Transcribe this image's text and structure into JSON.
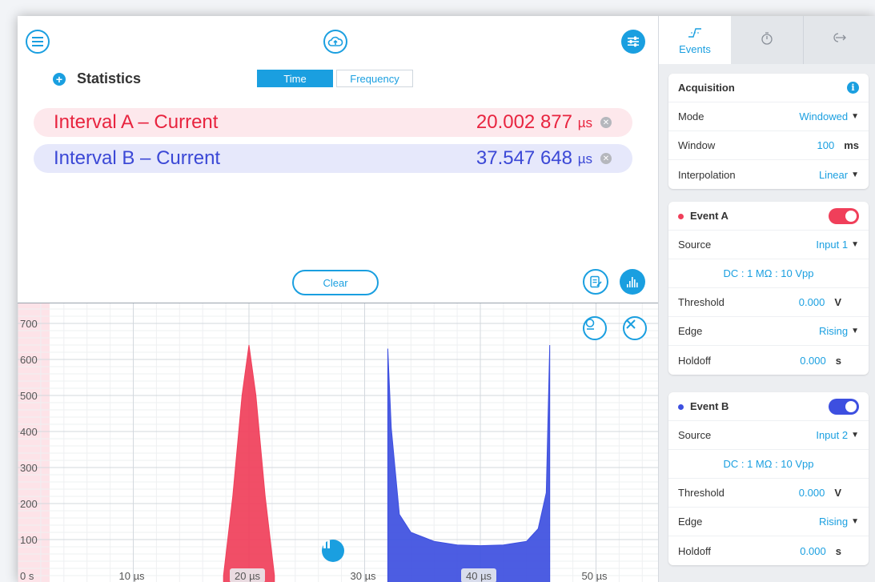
{
  "toolbar": {
    "menu_icon": "hamburger-menu-icon",
    "cloud_icon": "cloud-upload-icon",
    "settings_icon": "sliders-icon"
  },
  "statistics": {
    "title": "Statistics",
    "tabs": [
      "Time",
      "Frequency"
    ],
    "active_tab": "Time",
    "rows": [
      {
        "name": "Interval A – Current",
        "value": "20.002 877",
        "unit": "µs",
        "color": "#e8243f"
      },
      {
        "name": "Interval B – Current",
        "value": "37.547 648",
        "unit": "µs",
        "color": "#3b48d6"
      }
    ],
    "clear_label": "Clear"
  },
  "chart_data": {
    "type": "bar",
    "title": "",
    "xlabel": "",
    "ylabel": "",
    "x_ticks": [
      "0 s",
      "10 µs",
      "20 µs",
      "30 µs",
      "40 µs",
      "50 µs"
    ],
    "y_ticks": [
      "100",
      "200",
      "300",
      "400",
      "500",
      "600",
      "700"
    ],
    "xlim_us": [
      0,
      54
    ],
    "ylim": [
      0,
      760
    ],
    "grid": true,
    "series": [
      {
        "color": "#f03f5a",
        "shape": "triangle",
        "x_us": [
          17.8,
          18.6,
          19.4,
          20.0,
          20.6,
          21.4,
          22.2
        ],
        "y": [
          0,
          220,
          500,
          640,
          500,
          220,
          0
        ]
      },
      {
        "color": "#3d4fe0",
        "shape": "u-shape",
        "x_us": [
          32.0,
          32.3,
          33,
          34,
          36,
          38,
          40,
          42,
          44,
          45,
          45.7,
          46.0
        ],
        "y": [
          630,
          410,
          170,
          120,
          95,
          85,
          83,
          85,
          95,
          130,
          230,
          640
        ]
      }
    ]
  },
  "side_panel": {
    "tabs": [
      {
        "label": "Events",
        "icon": "edge-trigger-icon",
        "active": true
      },
      {
        "label": "",
        "icon": "stopwatch-icon",
        "active": false
      },
      {
        "label": "",
        "icon": "arrow-out-icon",
        "active": false
      }
    ],
    "acquisition": {
      "title": "Acquisition",
      "mode_label": "Mode",
      "mode_value": "Windowed",
      "window_label": "Window",
      "window_value": "100",
      "window_unit": "ms",
      "interp_label": "Interpolation",
      "interp_value": "Linear"
    },
    "event_a": {
      "title": "Event A",
      "color": "#f03f5a",
      "source_label": "Source",
      "source_value": "Input 1",
      "coupling": "DC : 1 MΩ : 10 Vpp",
      "threshold_label": "Threshold",
      "threshold_value": "0.000",
      "threshold_unit": "V",
      "edge_label": "Edge",
      "edge_value": "Rising",
      "holdoff_label": "Holdoff",
      "holdoff_value": "0.000",
      "holdoff_unit": "s"
    },
    "event_b": {
      "title": "Event B",
      "color": "#3d4fe0",
      "source_label": "Source",
      "source_value": "Input 2",
      "coupling": "DC : 1 MΩ : 10 Vpp",
      "threshold_label": "Threshold",
      "threshold_value": "0.000",
      "threshold_unit": "V",
      "edge_label": "Edge",
      "edge_value": "Rising",
      "holdoff_label": "Holdoff",
      "holdoff_value": "0.000",
      "holdoff_unit": "s"
    }
  }
}
